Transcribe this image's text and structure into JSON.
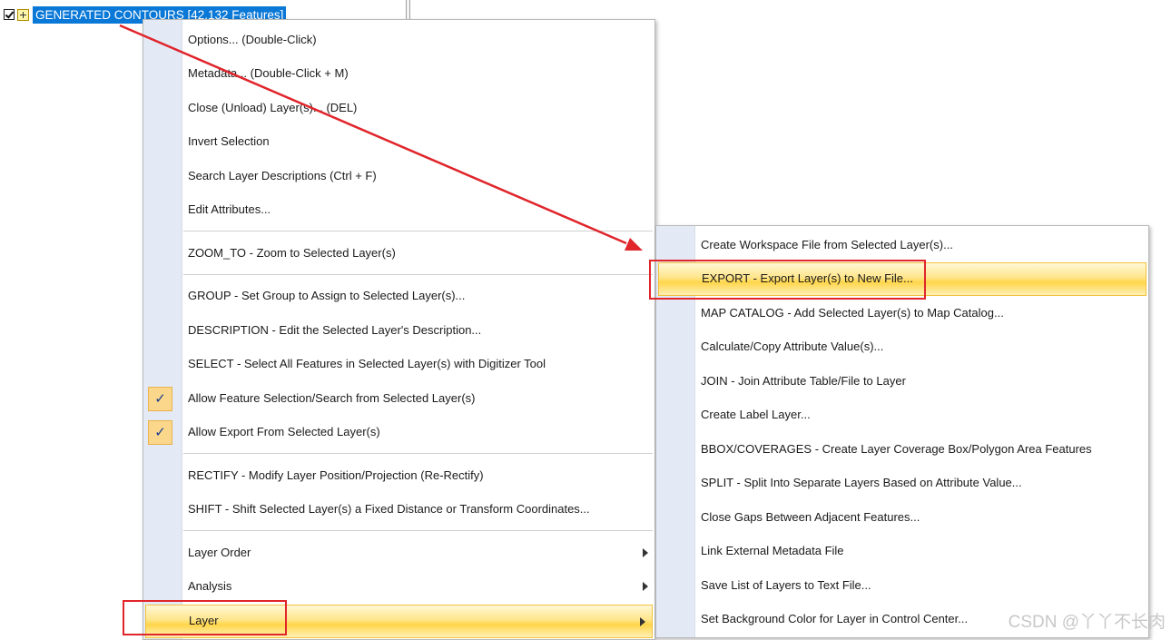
{
  "tree": {
    "layer_title": "GENERATED CONTOURS [42,132 Features]"
  },
  "context_menu": {
    "items": [
      {
        "label": "Options... (Double-Click)"
      },
      {
        "label": "Metadata... (Double-Click + M)"
      },
      {
        "label": "Close (Unload) Layer(s)... (DEL)"
      },
      {
        "label": "Invert Selection"
      },
      {
        "label": "Search Layer Descriptions (Ctrl + F)"
      },
      {
        "label": "Edit Attributes..."
      },
      {
        "label": "ZOOM_TO - Zoom to Selected Layer(s)"
      },
      {
        "label": "GROUP - Set Group to Assign to Selected Layer(s)..."
      },
      {
        "label": "DESCRIPTION - Edit the Selected Layer's Description..."
      },
      {
        "label": "SELECT - Select All Features in Selected Layer(s) with Digitizer Tool"
      },
      {
        "label": "Allow Feature Selection/Search from Selected Layer(s)",
        "checked": true
      },
      {
        "label": "Allow Export From Selected Layer(s)",
        "checked": true
      },
      {
        "label": "RECTIFY - Modify Layer Position/Projection (Re-Rectify)"
      },
      {
        "label": "SHIFT - Shift Selected Layer(s) a Fixed Distance or Transform Coordinates..."
      },
      {
        "label": "Layer Order"
      },
      {
        "label": "Analysis"
      },
      {
        "label": "Layer"
      }
    ],
    "check_glyph": "✓"
  },
  "submenu": {
    "items": [
      {
        "label": "Create Workspace File from Selected Layer(s)..."
      },
      {
        "label": "EXPORT - Export Layer(s) to New File..."
      },
      {
        "label": "MAP CATALOG - Add Selected Layer(s) to Map Catalog..."
      },
      {
        "label": "Calculate/Copy Attribute Value(s)..."
      },
      {
        "label": "JOIN - Join Attribute Table/File to Layer"
      },
      {
        "label": "Create Label Layer..."
      },
      {
        "label": "BBOX/COVERAGES  - Create Layer Coverage Box/Polygon Area Features"
      },
      {
        "label": "SPLIT - Split Into Separate Layers Based on Attribute Value..."
      },
      {
        "label": "Close Gaps Between Adjacent Features..."
      },
      {
        "label": "Link External Metadata File"
      },
      {
        "label": "Save List of Layers to Text File..."
      },
      {
        "label": "Set Background Color for Layer in Control Center..."
      }
    ]
  },
  "watermark": "CSDN @丫丫不长肉",
  "colors": {
    "selection_blue": "#0a78d7",
    "highlight_gold": "#ffd54a",
    "annotation_red": "#e0252b",
    "gutter": "#e3eaf6"
  }
}
